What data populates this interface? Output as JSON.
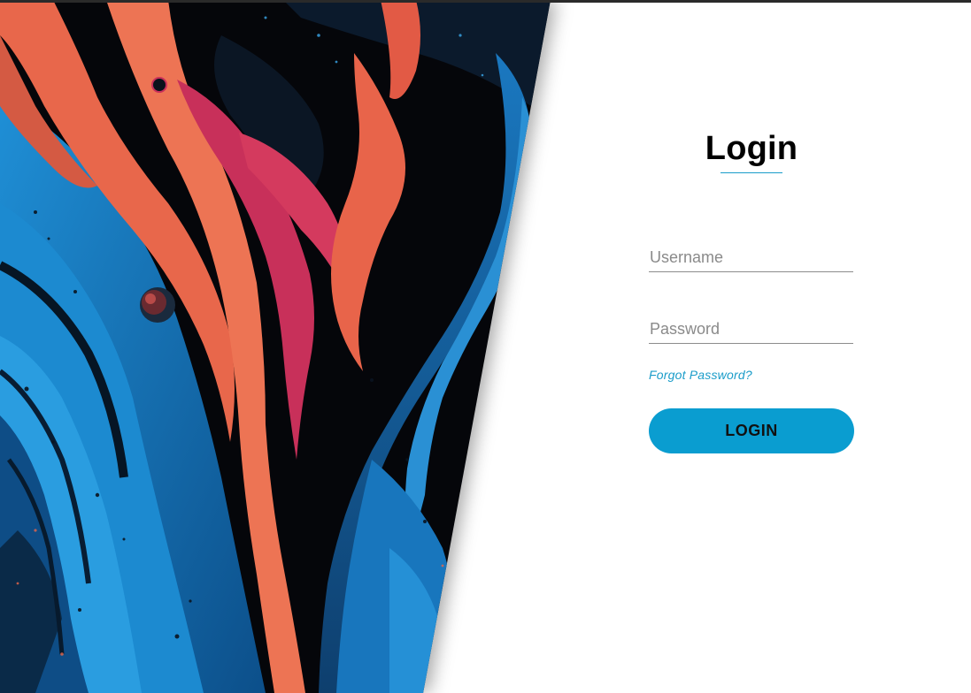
{
  "login": {
    "title": "Login",
    "username_placeholder": "Username",
    "password_placeholder": "Password",
    "forgot_password": "Forgot Password?",
    "submit_label": "LOGIN"
  },
  "background": {
    "image": "abstract-fluid-art",
    "colors": [
      "#05060a",
      "#1e6fb0",
      "#e86a4f",
      "#c82d5a"
    ]
  },
  "theme": {
    "accent": "#0a9dd0",
    "link": "#1a9cc9"
  }
}
